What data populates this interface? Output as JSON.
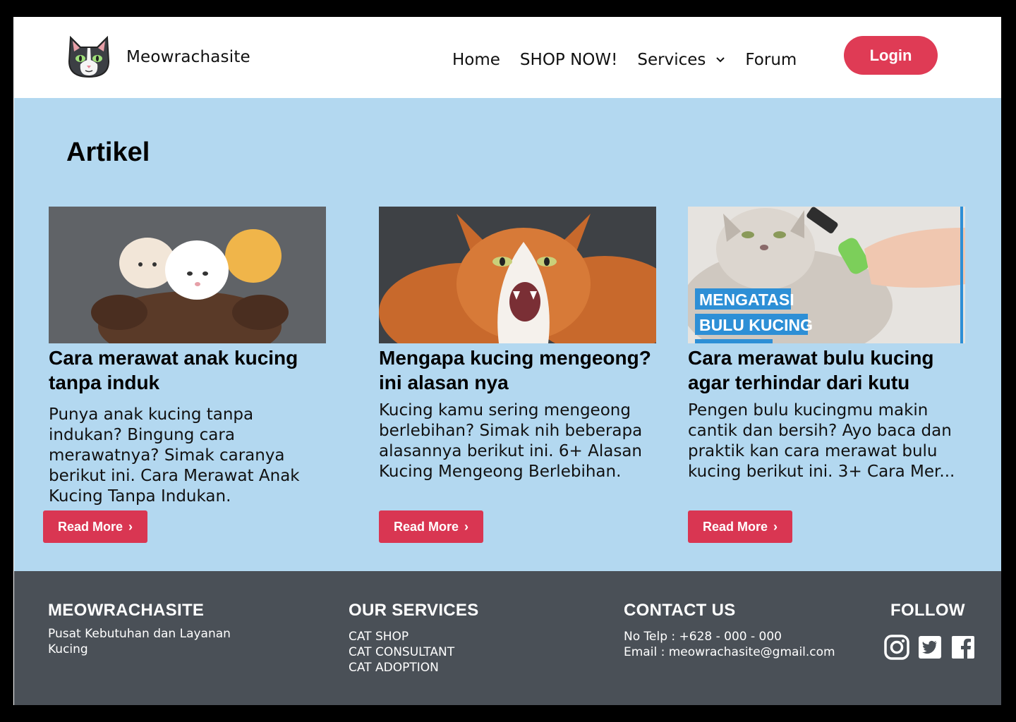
{
  "header": {
    "brand": "Meowrachasite",
    "nav": [
      "Home",
      "SHOP NOW!",
      "Services",
      "Forum"
    ],
    "login_label": "Login"
  },
  "main": {
    "title": "Artikel",
    "articles": [
      {
        "title": "Cara merawat anak kucing tanpa induk",
        "excerpt": "Punya anak kucing tanpa indukan? Bingung cara merawatnya? Simak caranya berikut ini. Cara Merawat Anak Kucing Tanpa Indukan.",
        "button": "Read More"
      },
      {
        "title": "Mengapa kucing mengeong? ini alasan nya",
        "excerpt": "Kucing kamu sering mengeong berlebihan? Simak nih beberapa alasannya berikut ini. 6+ Alasan Kucing Mengeong Berlebihan.",
        "button": "Read More"
      },
      {
        "title": "Cara merawat bulu kucing agar terhindar dari kutu",
        "excerpt": "Pengen bulu kucingmu makin cantik dan bersih? Ayo baca dan praktik kan cara merawat bulu kucing berikut ini. 3+ Cara Mer...",
        "button": "Read More",
        "image_caption_1": "MENGATASI",
        "image_caption_2": "BULU KUCING"
      }
    ]
  },
  "footer": {
    "brand_heading": "MEOWRACHASITE",
    "brand_text_1": "Pusat Kebutuhan dan Layanan",
    "brand_text_2": "Kucing",
    "services_heading": "OUR SERVICES",
    "services": [
      "CAT SHOP",
      "CAT CONSULTANT",
      "CAT ADOPTION"
    ],
    "contact_heading": "CONTACT US",
    "phone": "No Telp : +628 - 000 - 000",
    "email": "Email : meowrachasite@gmail.com",
    "follow_heading": "FOLLOW",
    "social_icons": [
      "instagram-icon",
      "twitter-icon",
      "facebook-icon"
    ]
  },
  "colors": {
    "accent": "#df3b55",
    "main_bg": "#b3d8f0",
    "footer_bg": "#4a5057"
  }
}
